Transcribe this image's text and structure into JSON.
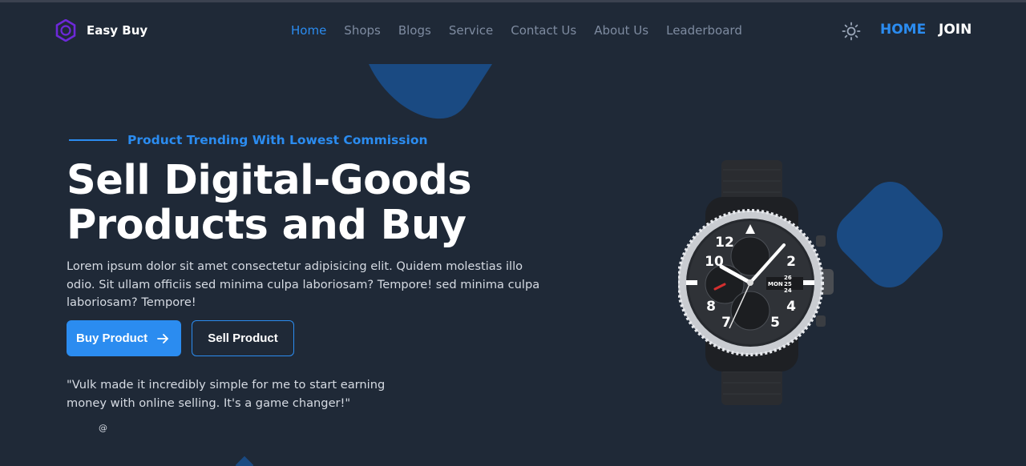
{
  "brand": {
    "name": "Easy Buy"
  },
  "nav": {
    "items": [
      {
        "label": "Home",
        "active": true
      },
      {
        "label": "Shops",
        "active": false
      },
      {
        "label": "Blogs",
        "active": false
      },
      {
        "label": "Service",
        "active": false
      },
      {
        "label": "Contact Us",
        "active": false
      },
      {
        "label": "About Us",
        "active": false
      },
      {
        "label": "Leaderboard",
        "active": false
      }
    ],
    "theme_icon": "sun-icon",
    "home_label": "HOME",
    "join_label": "JOIN"
  },
  "hero": {
    "tagline": "Product Trending With Lowest Commission",
    "headline_line1": "Sell Digital-Goods",
    "headline_line2": "Products and Buy",
    "description": "Lorem ipsum dolor sit amet consectetur adipisicing elit. Quidem molestias illo odio. Sit ullam officiis sed minima culpa laboriosam? Tempore! sed minima culpa laboriosam? Tempore!",
    "buy_button": "Buy Product",
    "sell_button": "Sell Product",
    "quote": "\"Vulk made it incredibly simple for me to start earning money with online selling. It's a game changer!\"",
    "quote_author": "@"
  },
  "watch": {
    "numerals": [
      "10",
      "12",
      "2",
      "4",
      "5",
      "7",
      "8"
    ],
    "date_window": [
      "MON",
      "26",
      "25",
      "24"
    ]
  },
  "colors": {
    "background": "#1f2937",
    "accent": "#2b8cf0",
    "muted_nav": "#7e8ba0",
    "logo_purple": "#6d28d9",
    "deco_blue": "#1a4a82"
  }
}
